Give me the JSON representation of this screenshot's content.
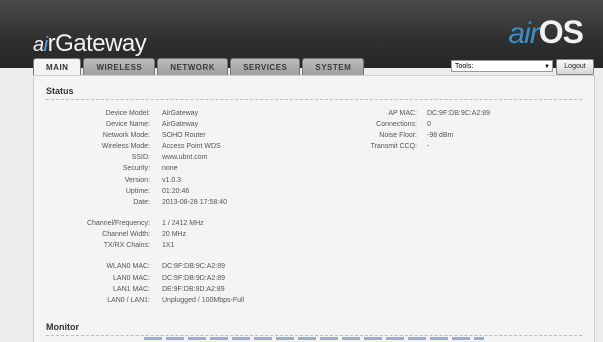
{
  "header": {
    "brand_prefix_a": "a",
    "brand_prefix_i": "i",
    "brand_rest": "rGateway",
    "os_prefix": "air",
    "os_suffix": "OS"
  },
  "tabs": [
    "MAIN",
    "WIRELESS",
    "NETWORK",
    "SERVICES",
    "SYSTEM"
  ],
  "active_tab": "MAIN",
  "toolbar": {
    "tools_value": "Tools:",
    "logout_label": "Logout"
  },
  "status": {
    "title": "Status",
    "left": [
      {
        "label": "Device Model:",
        "value": "AirGateway"
      },
      {
        "label": "Device Name:",
        "value": "AirGateway"
      },
      {
        "label": "Network Mode:",
        "value": "SOHO Router"
      },
      {
        "label": "Wireless Mode:",
        "value": "Access Point WDS"
      },
      {
        "label": "SSID:",
        "value": "www.ubnt.com"
      },
      {
        "label": "Security:",
        "value": "none"
      },
      {
        "label": "Version:",
        "value": "v1.0.3"
      },
      {
        "label": "Uptime:",
        "value": "01:20:46"
      },
      {
        "label": "Date:",
        "value": "2013-08-28 17:58:40"
      },
      {
        "label": "Channel/Frequency:",
        "value": "1 / 2412 MHz"
      },
      {
        "label": "Channel Width:",
        "value": "20 MHz"
      },
      {
        "label": "TX/RX Chains:",
        "value": "1X1"
      },
      {
        "label": "WLAN0 MAC:",
        "value": "DC:9F:DB:9C:A2:89"
      },
      {
        "label": "LAN0 MAC:",
        "value": "DC:9F:DB:9D:A2:89"
      },
      {
        "label": "LAN1 MAC:",
        "value": "DE:9F:DB:9D:A2:89"
      },
      {
        "label": "LAN0 / LAN1:",
        "value": "Unplugged / 100Mbps-Full"
      }
    ],
    "right": [
      {
        "label": "AP MAC:",
        "value": "DC:9F:DB:9C:A2:89"
      },
      {
        "label": "Connections:",
        "value": "0"
      },
      {
        "label": "Noise Floor:",
        "value": "-98 dBm"
      },
      {
        "label": "Transmit CCQ:",
        "value": "-"
      }
    ]
  },
  "monitor": {
    "title": "Monitor"
  }
}
